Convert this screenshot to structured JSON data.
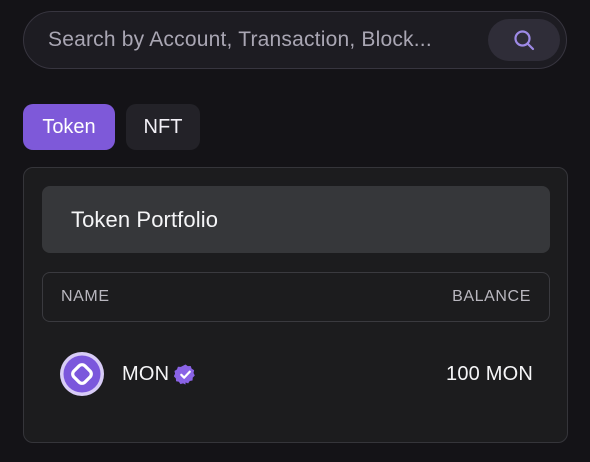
{
  "search": {
    "placeholder": "Search by Account, Transaction, Block...",
    "button_icon": "search-icon"
  },
  "tabs": [
    {
      "label": "Token",
      "active": true
    },
    {
      "label": "NFT",
      "active": false
    }
  ],
  "portfolio": {
    "title": "Token Portfolio",
    "columns": {
      "name": "NAME",
      "balance": "BALANCE"
    },
    "rows": [
      {
        "name": "MON",
        "balance": "100 MON",
        "verified": true,
        "logo_icon": "monad-logo-icon",
        "verified_icon": "verified-badge-icon"
      }
    ]
  },
  "colors": {
    "accent": "#7e59d9",
    "background": "#141317",
    "panel": "#1c1c1e",
    "header": "#36373a"
  }
}
